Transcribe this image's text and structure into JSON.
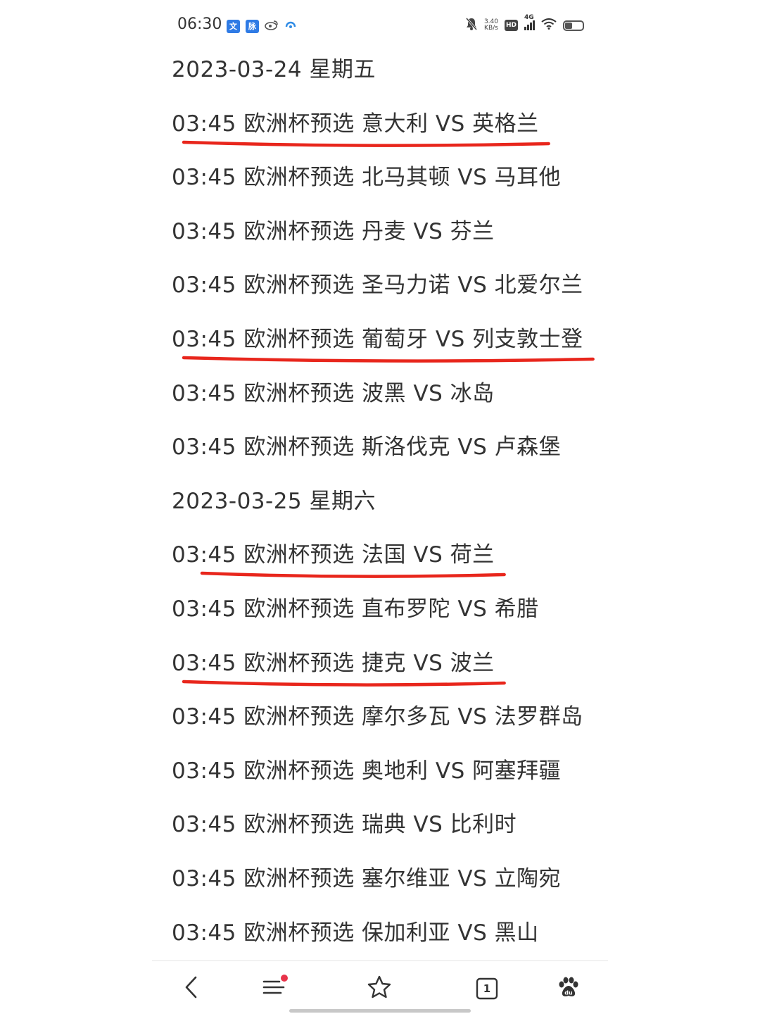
{
  "status_bar": {
    "time": "06:30",
    "app_icons": [
      "文",
      "脉"
    ],
    "net_speed_value": "3.40",
    "net_speed_unit": "KB/s",
    "hd_label": "HD",
    "network_label": "4G",
    "battery_level": 0.45
  },
  "schedule": {
    "lines": [
      {
        "kind": "date",
        "text": "2023-03-24 星期五",
        "underlined": false
      },
      {
        "kind": "match",
        "text": "03:45 欧洲杯预选 意大利 VS 英格兰",
        "underlined": true
      },
      {
        "kind": "match",
        "text": "03:45 欧洲杯预选 北马其顿 VS 马耳他",
        "underlined": false
      },
      {
        "kind": "match",
        "text": "03:45 欧洲杯预选 丹麦 VS 芬兰",
        "underlined": false
      },
      {
        "kind": "match",
        "text": "03:45 欧洲杯预选 圣马力诺 VS 北爱尔兰",
        "underlined": false
      },
      {
        "kind": "match",
        "text": "03:45 欧洲杯预选 葡萄牙 VS 列支敦士登",
        "underlined": true
      },
      {
        "kind": "match",
        "text": "03:45 欧洲杯预选 波黑 VS 冰岛",
        "underlined": false
      },
      {
        "kind": "match",
        "text": "03:45 欧洲杯预选 斯洛伐克 VS 卢森堡",
        "underlined": false
      },
      {
        "kind": "date",
        "text": "2023-03-25 星期六",
        "underlined": false
      },
      {
        "kind": "match",
        "text": "03:45 欧洲杯预选 法国 VS 荷兰",
        "underlined": true
      },
      {
        "kind": "match",
        "text": "03:45 欧洲杯预选 直布罗陀 VS 希腊",
        "underlined": false
      },
      {
        "kind": "match",
        "text": "03:45 欧洲杯预选 捷克 VS 波兰",
        "underlined": true
      },
      {
        "kind": "match",
        "text": "03:45 欧洲杯预选 摩尔多瓦 VS 法罗群岛",
        "underlined": false
      },
      {
        "kind": "match",
        "text": "03:45 欧洲杯预选 奥地利 VS 阿塞拜疆",
        "underlined": false
      },
      {
        "kind": "match",
        "text": "03:45 欧洲杯预选 瑞典 VS 比利时",
        "underlined": false
      },
      {
        "kind": "match",
        "text": "03:45 欧洲杯预选 塞尔维亚 VS 立陶宛",
        "underlined": false
      },
      {
        "kind": "match",
        "text": "03:45 欧洲杯预选 保加利亚 VS 黑山",
        "underlined": false
      }
    ]
  },
  "bottom_nav": {
    "tab_count": "1",
    "items": [
      "back-icon",
      "menu-icon",
      "star-icon",
      "tabs-icon",
      "baidu-paw-icon"
    ],
    "menu_has_notification": true
  },
  "colors": {
    "text": "#333333",
    "underline": "#e8261c",
    "notification_dot": "#e8334a",
    "nav_icon": "#333333"
  }
}
